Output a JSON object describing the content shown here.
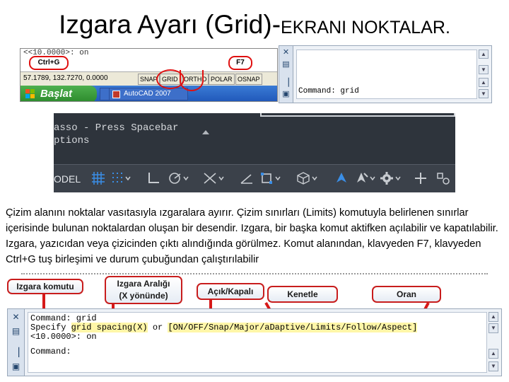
{
  "slide": {
    "title_main": "Izgara Ayarı (Grid)-",
    "title_suffix": "EKRANI NOKTALAR.",
    "paragraph": "Çizim alanını noktalar vasıtasıyla ızgaralara ayırır. Çizim sınırları (Limits) komutuyla belirlenen sınırlar içerisinde bulunan noktalardan oluşan bir desendir. Izgara, bir başka komut aktifken açılabilir ve kapatılabilir. Izgara, yazıcıdan veya çizicinden çıktı alındığında görülmez. Komut alanından, klavyeden F7, klavyeden Ctrl+G tuş birleşimi ve durum çubuğundan çalıştırılabilir"
  },
  "old_ui": {
    "top_text": "<<10.0000>: on",
    "coords": "57.1789, 132.7270, 0.0000",
    "status_buttons": [
      "SNAP",
      "GRID",
      "ORTHO",
      "POLAR",
      "OSNAP"
    ],
    "taskbar_start": "Başlat",
    "taskbar_app": "AutoCAD 2007",
    "callout_left": "Ctrl+G",
    "callout_right": "F7"
  },
  "small_cmd": {
    "command_line": "Command: grid",
    "side_icons": [
      "close-icon",
      "pin-icon"
    ],
    "scroll_arrows": [
      "▲",
      "▼",
      "▲",
      "▼"
    ]
  },
  "dark_ui": {
    "prompt_line1": "asso - Press Spacebar",
    "prompt_line2": "ptions",
    "model_label": "ODEL",
    "accent_color": "#3a8ee6",
    "icons": [
      "grid-icon",
      "snap-icon",
      "ortho-icon",
      "polar-icon",
      "osnap-icon",
      "otrack-icon",
      "lineweight-icon",
      "selection-cycling-icon",
      "3d-osnap-icon",
      "annotation-scale-icon",
      "workspace-icon",
      "gear-icon",
      "plus-icon",
      "hardware-acceleration-icon"
    ]
  },
  "labels": {
    "izgara_komutu": "Izgara komutu",
    "izgara_araligi_1": "Izgara Aralığı",
    "izgara_araligi_2": "(X yönünde)",
    "acik_kapali": "Açık/Kapalı",
    "kenetle": "Kenetle",
    "oran": "Oran"
  },
  "big_cmd": {
    "line1": "Command: grid",
    "line2_prefix": "Specify ",
    "line2_spacing": "grid spacing(X)",
    "line2_or": " or ",
    "line2_options": "[ON/OFF/Snap/Major/aDaptive/Limits/Follow/Aspect]",
    "line3": "<10.0000>: on",
    "line4": "Command:",
    "highlight_color": "#fff6a8"
  }
}
